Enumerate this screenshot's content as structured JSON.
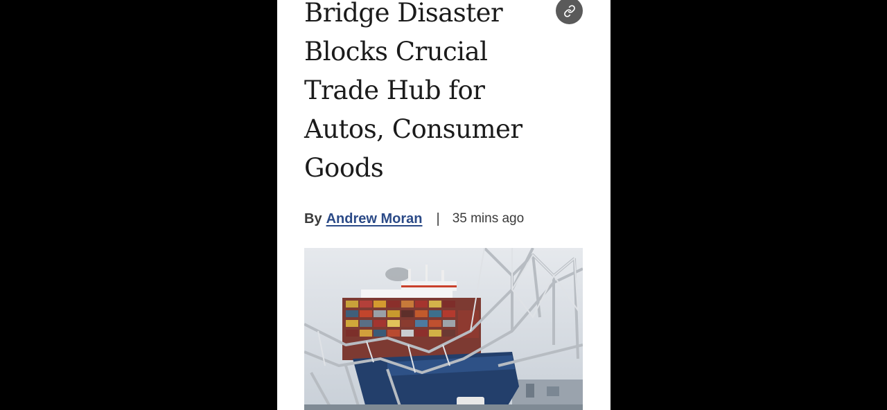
{
  "article": {
    "headline_lines": [
      "Bridge Disaster",
      "Blocks Crucial",
      "Trade Hub for",
      "Autos, Consumer",
      "Goods"
    ],
    "byline": {
      "by_label": "By",
      "author": "Andrew Moran",
      "separator": "|",
      "timestamp": "35 mins ago"
    },
    "share": {
      "icon": "link-icon"
    },
    "hero_image": {
      "icon": "photo"
    }
  },
  "colors": {
    "background": "#000000",
    "page": "#ffffff",
    "headline": "#1b1b1b",
    "author_link": "#2b4a87",
    "share_button": "#5a5a5a"
  }
}
